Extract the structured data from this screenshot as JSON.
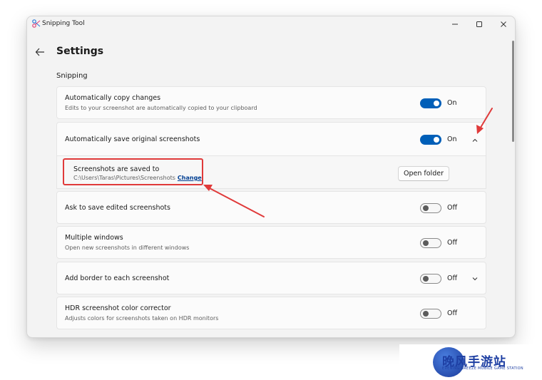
{
  "window": {
    "app_title": "Snipping Tool",
    "controls": {
      "minimize": "—",
      "maximize": "☐",
      "close": "✕"
    }
  },
  "header": {
    "page_title": "Settings",
    "back_icon": "back-arrow-icon"
  },
  "section": {
    "title": "Snipping"
  },
  "settings": [
    {
      "label": "Automatically copy changes",
      "description": "Edits to your screenshot are automatically copied to your clipboard",
      "state": "On"
    },
    {
      "label": "Automatically save original screenshots",
      "state": "On",
      "expanded": true
    },
    {
      "label": "Ask to save edited screenshots",
      "state": "Off"
    },
    {
      "label": "Multiple windows",
      "description": "Open new screenshots in different windows",
      "state": "Off"
    },
    {
      "label": "Add border to each screenshot",
      "state": "Off",
      "expanded": false
    },
    {
      "label": "HDR screenshot color corrector",
      "description": "Adjusts colors for screenshots taken on HDR monitors",
      "state": "Off"
    }
  ],
  "save_location": {
    "label": "Screenshots are saved to",
    "path": "C:\\Users\\Taras\\Pictures\\Screenshots",
    "change_link": "Change",
    "open_folder_button": "Open folder"
  },
  "watermark": {
    "title": "晚风手游站",
    "subtitle": "EVENING BREEZE MOBILE GAME STATION"
  },
  "colors": {
    "accent": "#005fb8",
    "annotation": "#e03a3a",
    "window_bg": "#f3f3f3",
    "card_bg": "#fbfbfb"
  }
}
